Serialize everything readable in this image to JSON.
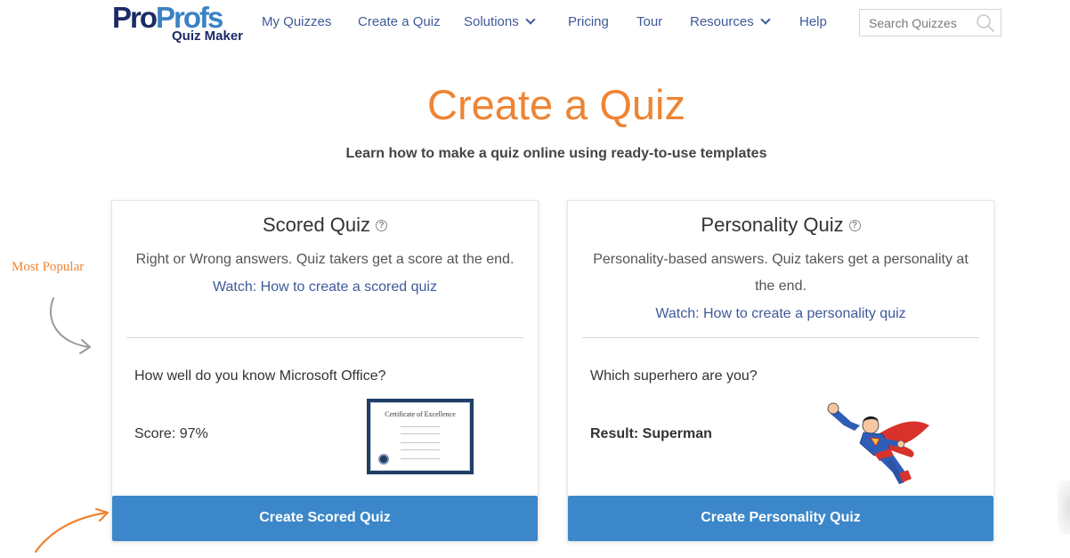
{
  "brand": {
    "logo_pro": "Pro",
    "logo_profs": "Profs",
    "logo_sub": "Quiz Maker"
  },
  "nav": {
    "items": [
      {
        "label": "My Quizzes",
        "has_dropdown": false
      },
      {
        "label": "Create a Quiz",
        "has_dropdown": false
      },
      {
        "label": "Solutions",
        "has_dropdown": true
      },
      {
        "label": "Pricing",
        "has_dropdown": false
      },
      {
        "label": "Tour",
        "has_dropdown": false
      },
      {
        "label": "Resources",
        "has_dropdown": true
      },
      {
        "label": "Help",
        "has_dropdown": false
      }
    ],
    "search_placeholder": "Search Quizzes",
    "search_value": ""
  },
  "hero": {
    "title": "Create a Quiz",
    "subtitle": "Learn how to make a quiz online using ready-to-use templates"
  },
  "annotation": {
    "most_popular": "Most Popular"
  },
  "cards": {
    "scored": {
      "title": "Scored Quiz",
      "help": "?",
      "description": "Right or Wrong answers. Quiz takers get a score at the end.",
      "watch_link": "Watch: How to create a scored quiz",
      "sample_question": "How well do you know Microsoft Office?",
      "sample_result": "Score: 97%",
      "certificate_title": "Certificate of Excellence",
      "cta": "Create Scored Quiz"
    },
    "personality": {
      "title": "Personality Quiz",
      "help": "?",
      "description": "Personality-based answers. Quiz takers get a personality at the end.",
      "watch_link": "Watch: How to create a personality quiz",
      "sample_question": "Which superhero are you?",
      "sample_result": "Result: Superman",
      "cta": "Create Personality Quiz"
    }
  },
  "colors": {
    "accent_orange": "#ee8434",
    "link_blue": "#3f5a99",
    "button_blue": "#3b87c9",
    "brand_navy": "#1c2a66",
    "brand_blue": "#3b82c4"
  }
}
